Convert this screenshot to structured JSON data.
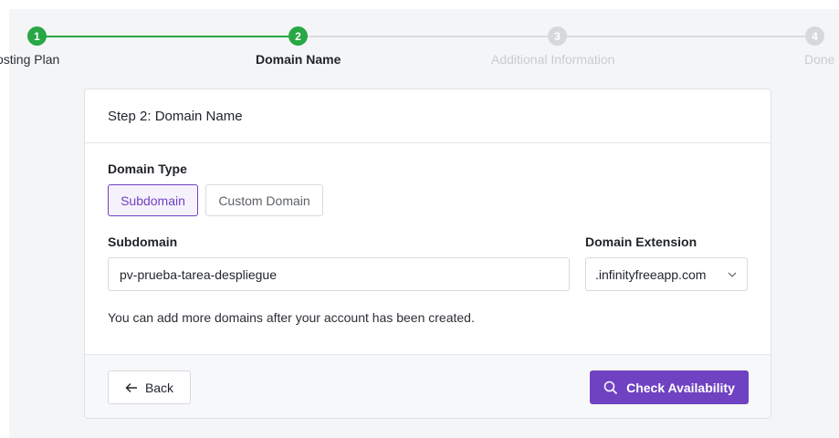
{
  "stepper": {
    "steps": [
      {
        "number": "1",
        "label": "osting Plan",
        "state": "done"
      },
      {
        "number": "2",
        "label": "Domain Name",
        "state": "active"
      },
      {
        "number": "3",
        "label": "Additional Information",
        "state": "pending"
      },
      {
        "number": "4",
        "label": "Done",
        "state": "pending"
      }
    ]
  },
  "card": {
    "title": "Step 2: Domain Name",
    "domain_type_label": "Domain Type",
    "domain_type_options": [
      "Subdomain",
      "Custom Domain"
    ],
    "domain_type_selected": "Subdomain",
    "subdomain_label": "Subdomain",
    "subdomain_value": "pv-prueba-tarea-despliegue",
    "extension_label": "Domain Extension",
    "extension_value": ".infinityfreeapp.com",
    "help_text": "You can add more domains after your account has been created.",
    "back_label": "Back",
    "check_label": "Check Availability"
  },
  "icons": {
    "back": "arrow-left-icon",
    "check": "search-icon",
    "extension": "chevron-down-icon"
  },
  "colors": {
    "accent": "#6f42c1",
    "success": "#28a745",
    "pending": "#d5d8dd"
  }
}
